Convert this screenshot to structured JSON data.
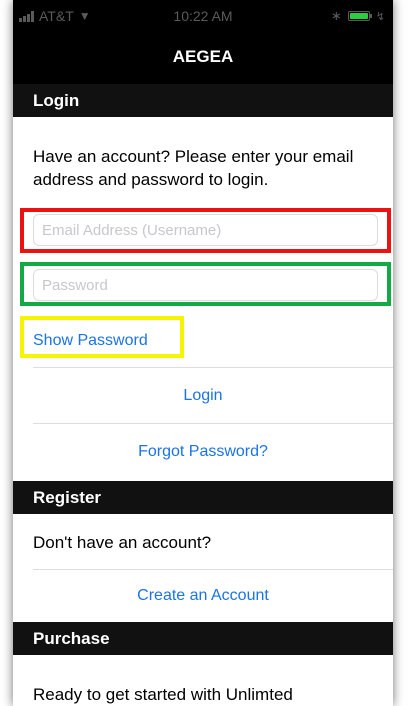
{
  "status_bar": {
    "carrier": "AT&T",
    "time": "10:22 AM"
  },
  "nav": {
    "title": "AEGEA"
  },
  "login": {
    "header": "Login",
    "description": "Have an account? Please enter your email address and password to login.",
    "email_placeholder": "Email Address (Username)",
    "password_placeholder": "Password",
    "show_password_label": "Show Password",
    "login_label": "Login",
    "forgot_password_label": "Forgot Password?"
  },
  "register": {
    "header": "Register",
    "prompt": "Don't have an account?",
    "create_account_label": "Create an Account"
  },
  "purchase": {
    "header": "Purchase",
    "text": "Ready to get started with Unlimted"
  },
  "colors": {
    "email_highlight": "#ee1111",
    "password_highlight": "#11aa44",
    "show_password_highlight": "#f5f500",
    "link": "#1a73e8"
  }
}
